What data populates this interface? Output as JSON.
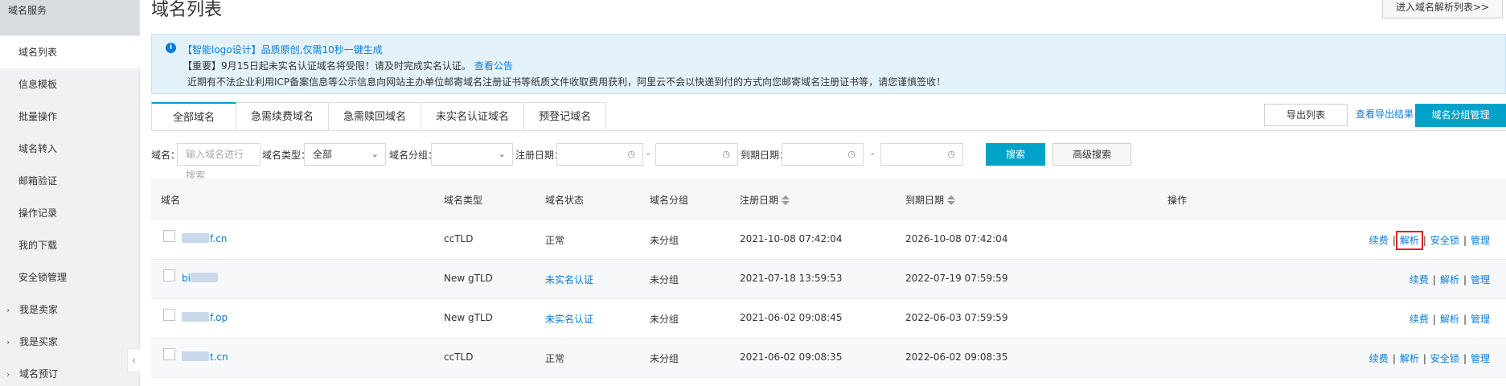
{
  "sidebar": {
    "header": "域名服务",
    "items": [
      {
        "label": "域名列表",
        "active": true
      },
      {
        "label": "信息模板"
      },
      {
        "label": "批量操作"
      },
      {
        "label": "域名转入"
      },
      {
        "label": "邮箱验证"
      },
      {
        "label": "操作记录"
      },
      {
        "label": "我的下载"
      },
      {
        "label": "安全锁管理"
      }
    ],
    "groups": [
      {
        "label": "我是卖家"
      },
      {
        "label": "我是买家"
      },
      {
        "label": "域名预订"
      }
    ]
  },
  "header": {
    "title": "域名列表",
    "dns_button": "进入域名解析列表>>"
  },
  "notice": {
    "line1": "【智能logo设计】品质原创,仅需10秒一键生成",
    "line2": "【重要】9月15日起未实名认证域名将受限！请及时完成实名认证。",
    "line2_link": "查看公告",
    "line3": "近期有不法企业利用ICP备案信息等公示信息向网站主办单位邮寄域名注册证书等纸质文件收取费用获利，阿里云不会以快递到付的方式向您邮寄域名注册证书等，请您谨慎签收！"
  },
  "tabs": [
    "全部域名",
    "急需续费域名",
    "急需赎回域名",
    "未实名认证域名",
    "预登记域名"
  ],
  "toolbar": {
    "export": "导出列表",
    "view_export": "查看导出结果",
    "group_mgr": "域名分组管理"
  },
  "filters": {
    "domain_label": "域名：",
    "domain_placeholder": "输入域名进行搜索",
    "type_label": "域名类型：",
    "type_value": "全部",
    "group_label": "域名分组：",
    "group_value": "",
    "reg_label": "注册日期：",
    "exp_label": "到期日期：",
    "dash": "-",
    "search": "搜索",
    "advanced": "高级搜索"
  },
  "table": {
    "columns": {
      "domain": "域名",
      "type": "域名类型",
      "status": "域名状态",
      "group": "域名分组",
      "reg": "注册日期",
      "exp": "到期日期",
      "ops": "操作"
    },
    "rows": [
      {
        "domain": "f.cn",
        "type": "ccTLD",
        "status": "正常",
        "group": "未分组",
        "reg": "2021-10-08 07:42:04",
        "exp": "2026-10-08 07:42:04",
        "ops": [
          "续费",
          "解析",
          "安全锁",
          "管理"
        ]
      },
      {
        "domain": "bi",
        "type": "New gTLD",
        "status": "未实名认证",
        "group": "未分组",
        "reg": "2021-07-18 13:59:53",
        "exp": "2022-07-19 07:59:59",
        "ops": [
          "续费",
          "解析",
          "管理"
        ]
      },
      {
        "domain": "f.op",
        "type": "New gTLD",
        "status": "未实名认证",
        "group": "未分组",
        "reg": "2021-06-02 09:08:45",
        "exp": "2022-06-03 07:59:59",
        "ops": [
          "续费",
          "解析",
          "管理"
        ]
      },
      {
        "domain": "t.cn",
        "type": "ccTLD",
        "status": "正常",
        "group": "未分组",
        "reg": "2021-06-02 09:08:35",
        "exp": "2022-06-02 09:08:35",
        "ops": [
          "续费",
          "解析",
          "安全锁",
          "管理"
        ]
      }
    ]
  },
  "colors": {
    "accent": "#00a2ca",
    "link": "#0a7bd9",
    "highlight_box": "#e02020"
  }
}
